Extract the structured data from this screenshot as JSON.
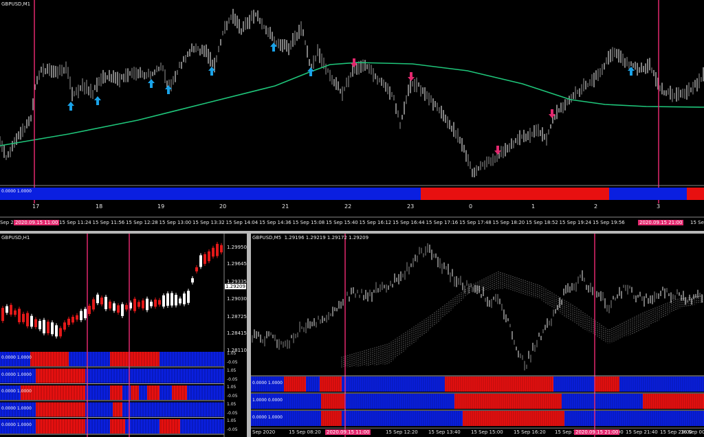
{
  "top": {
    "title": "GBPUSD,M1",
    "indicator_label": "0.0000 1.0000",
    "hour_labels": [
      "17",
      "18",
      "19",
      "20",
      "21",
      "22",
      "23",
      "0",
      "1",
      "2",
      "3"
    ],
    "time_labels": [
      "15 Sep 11:24",
      "15 Sep 11:56",
      "15 Sep 12:28",
      "15 Sep 13:00",
      "15 Sep 13:32",
      "15 Sep 14:04",
      "15 Sep 14:36",
      "15 Sep 15:08",
      "15 Sep 15:40",
      "15 Sep 16:12",
      "15 Sep 16:44",
      "15 Sep 17:16",
      "15 Sep 17:48",
      "15 Sep 18:20",
      "15 Sep 18:52",
      "15 Sep 19:24",
      "15 Sep 19:56"
    ],
    "time_first": "Sep 20",
    "time_hl_1": "2020.09.15 11:00",
    "time_hl_2": "2020.09.15 21:00",
    "time_last": "15 Sep"
  },
  "h1": {
    "title": "GBPUSD,H1",
    "prices": [
      "1.29950",
      "1.29645",
      "1.29335",
      "1.29030",
      "1.28725",
      "1.28415",
      "1.28110"
    ],
    "current_price": "1.29209",
    "ind_labels": [
      "0.0000 1.0000",
      "0.0000 1.0000",
      "0.0000 1.0000",
      "0.0000 1.0000",
      "0.0000 1.0000"
    ],
    "ind_scale_top": "1.05",
    "ind_scale_bottom": "-0.05"
  },
  "m5": {
    "title": "GBPUSD,M5  1.29196 1.29219 1.29172 1.29209",
    "ind_labels": [
      "0.0000 1.0000",
      "1.0000 0.0000",
      "0.0000 1.0000"
    ],
    "time_labels": [
      "Sep 2020",
      "15 Sep 08:20",
      "15 Sep 12:20",
      "15 Sep 13:40",
      "15 Sep 15:00",
      "15 Sep 16:20",
      "15 Sep 17:40",
      "15 Sep 19:00",
      "15 Sep 21:40",
      "15 Sep 23:00",
      "16 Sep 00:2"
    ],
    "time_hl_1": "2020.09.15 11:00",
    "time_hl_2": "2020.09.15 21:00"
  },
  "colors": {
    "bg": "#000000",
    "vline": "#e3286e",
    "ma": "#1fc77b",
    "arrow_up": "#1aa3e8",
    "arrow_down": "#e3286e",
    "bar_blue": "#0a1fe0",
    "bar_red": "#e81010",
    "bull": "#ffffff",
    "bear": "#e31919"
  }
}
